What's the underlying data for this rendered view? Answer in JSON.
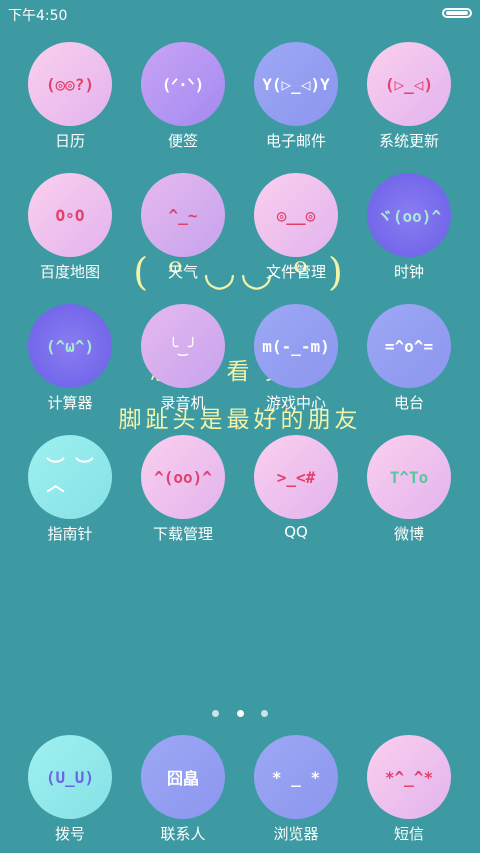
{
  "status": {
    "time": "下午4:50"
  },
  "wallpaper": {
    "face": "( ᵒ ◡◡ ᵒ )",
    "line1": "总 有   看 头        不",
    "line2": "脚趾头是最好的朋友"
  },
  "apps": [
    {
      "label": "日历",
      "icon": "(◎◎?)"
    },
    {
      "label": "便签",
      "icon": "(ᐟ·ᐠ)"
    },
    {
      "label": "电子邮件",
      "icon": "Y(▷_◁)Y"
    },
    {
      "label": "系统更新",
      "icon": "(▷_◁)"
    },
    {
      "label": "百度地图",
      "icon": "O∘O"
    },
    {
      "label": "天气",
      "icon": "^_~"
    },
    {
      "label": "文件管理",
      "icon": "◎__◎"
    },
    {
      "label": "时钟",
      "icon": "ヾ(oo)^"
    },
    {
      "label": "计算器",
      "icon": "(^ω^)"
    },
    {
      "label": "录音机",
      "icon": "╰‿╯"
    },
    {
      "label": "游戏中心",
      "icon": "m(-_-m)"
    },
    {
      "label": "电台",
      "icon": "=^o^="
    },
    {
      "label": "指南针",
      "icon": "︶ ︶\n︿"
    },
    {
      "label": "下载管理",
      "icon": "^(oo)^"
    },
    {
      "label": "QQ",
      "icon": ">_<#"
    },
    {
      "label": "微博",
      "icon": "T^To"
    }
  ],
  "dock": [
    {
      "label": "拨号",
      "icon": "(U_U)"
    },
    {
      "label": "联系人",
      "icon": "囧皛"
    },
    {
      "label": "浏览器",
      "icon": "* _ *"
    },
    {
      "label": "短信",
      "icon": "*^_^*"
    }
  ],
  "pager": {
    "pages": 3,
    "active": 2
  }
}
